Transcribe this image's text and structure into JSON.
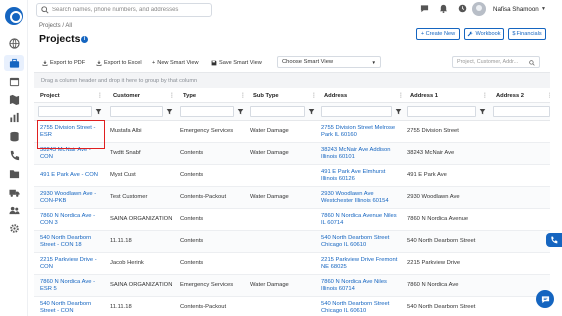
{
  "search": {
    "placeholder": "Search names, phone numbers, and addresses"
  },
  "user": {
    "name": "Nafisa Shamoon"
  },
  "breadcrumb": "Projects / All",
  "page": {
    "title": "Projects"
  },
  "header_buttons": [
    "+ Create New",
    "Workbook",
    "Financials"
  ],
  "toolbar": {
    "export_pdf": "Export to PDF",
    "export_excel": "Export to Excel",
    "new_view": "New Smart View",
    "save_view": "Save Smart View",
    "choose_view": "Choose Smart View",
    "grid_search_placeholder": "Project, Customer, Addr..."
  },
  "group_panel": "Drag a column header and drop it here to group by that column",
  "columns": [
    "Project",
    "Customer",
    "Type",
    "Sub Type",
    "Address",
    "Address 1",
    "Address 2"
  ],
  "rows": [
    {
      "project": "2755 Division Street - ESR",
      "customer": "Mustafa Albi",
      "type": "Emergency Services",
      "subtype": "Water Damage",
      "address": "2755 Division Street Melrose Park IL 60160",
      "address1": "2755 Division Street",
      "address2": ""
    },
    {
      "project": "38243 McNair Ave - CON",
      "customer": "Twdtt Snabf",
      "type": "Contents",
      "subtype": "Water Damage",
      "address": "38243 McNair Ave Addison Illinois 60101",
      "address1": "38243 McNair Ave",
      "address2": ""
    },
    {
      "project": "491 E Park Ave - CON",
      "customer": "Myst Cust",
      "type": "Contents",
      "subtype": "",
      "address": "491 E Park Ave Elmhurst Illinois 60126",
      "address1": "491 E Park Ave",
      "address2": ""
    },
    {
      "project": "2930 Woodlawn Ave - CON-PKB",
      "customer": "Test Customer",
      "type": "Contents-Packout",
      "subtype": "Water Damage",
      "address": "2930 Woodlawn Ave Westchester Illinois 60154",
      "address1": "2930 Woodlawn Ave",
      "address2": ""
    },
    {
      "project": "7860 N Nordica Ave - CON 3",
      "customer": "SAINA ORGANIZATION",
      "type": "Contents",
      "subtype": "",
      "address": "7860 N Nordica Avenue Niles IL 60714",
      "address1": "7860 N Nordica Avenue",
      "address2": ""
    },
    {
      "project": "540 North Dearborn Street - CON 18",
      "customer": "11.11.18",
      "type": "Contents",
      "subtype": "",
      "address": "540 North Dearborn Street Chicago IL 60610",
      "address1": "540 North Dearborn Street",
      "address2": ""
    },
    {
      "project": "2215 Parkview Drive - CON",
      "customer": "Jacob Herink",
      "type": "Contents",
      "subtype": "",
      "address": "2215 Parkview Drive Fremont NE 68025",
      "address1": "2215 Parkview Drive",
      "address2": ""
    },
    {
      "project": "7860 N Nordica Ave - ESR 5",
      "customer": "SAINA ORGANIZATION",
      "type": "Emergency Services",
      "subtype": "Water Damage",
      "address": "7860 N Nordica Ave Niles Illinois 60714",
      "address1": "7860 N Nordica Ave",
      "address2": ""
    },
    {
      "project": "540 North Dearborn Street - CON",
      "customer": "11.11.18",
      "type": "Contents-Packout",
      "subtype": "",
      "address": "540 North Dearborn Street Chicago IL 60610",
      "address1": "540 North Dearborn Street",
      "address2": ""
    }
  ],
  "colors": {
    "accent": "#1565c0",
    "highlight": "#e02020"
  },
  "icons": [
    "logo-icon",
    "globe-icon",
    "briefcase-icon",
    "calendar-icon",
    "map-icon",
    "chart-icon",
    "database-icon",
    "phone-icon",
    "folder-icon",
    "truck-icon",
    "team-icon",
    "gear-icon",
    "chat-icon",
    "bell-icon",
    "clock-icon"
  ]
}
